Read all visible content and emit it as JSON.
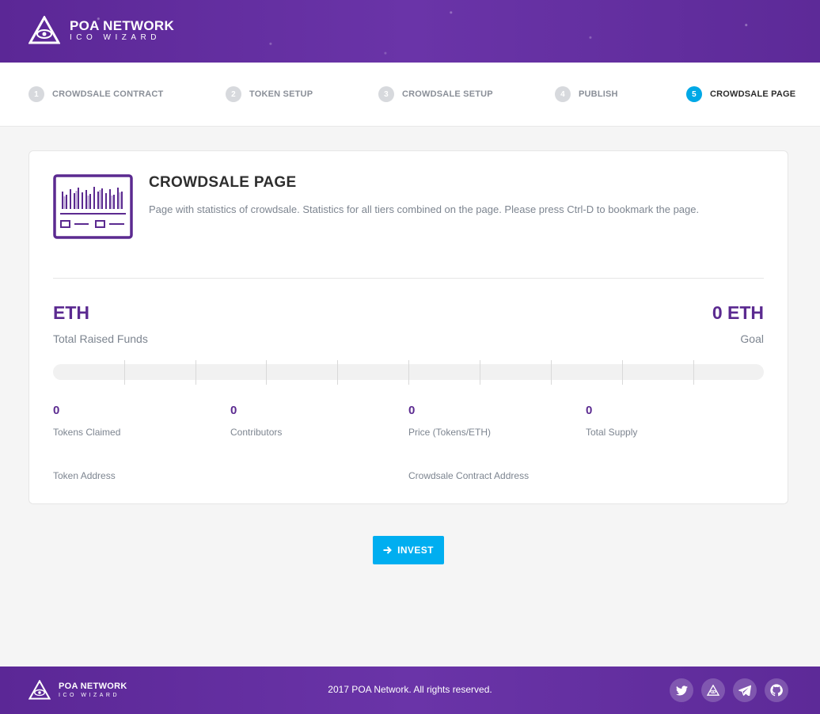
{
  "header": {
    "logo_title": "POA NETWORK",
    "logo_subtitle": "ICO WIZARD"
  },
  "steps": [
    {
      "num": "1",
      "label": "CROWDSALE CONTRACT",
      "active": false
    },
    {
      "num": "2",
      "label": "TOKEN SETUP",
      "active": false
    },
    {
      "num": "3",
      "label": "CROWDSALE SETUP",
      "active": false
    },
    {
      "num": "4",
      "label": "PUBLISH",
      "active": false
    },
    {
      "num": "5",
      "label": "CROWDSALE PAGE",
      "active": true
    }
  ],
  "card": {
    "title": "CROWDSALE PAGE",
    "description": "Page with statistics of crowdsale. Statistics for all tiers combined on the page. Please press Ctrl-D to bookmark the page.",
    "raised_value": "ETH",
    "raised_label": "Total Raised Funds",
    "goal_value": "0 ETH",
    "goal_label": "Goal",
    "progress_fraction": 0,
    "stats": [
      {
        "value": "0",
        "label": "Tokens Claimed"
      },
      {
        "value": "0",
        "label": "Contributors"
      },
      {
        "value": "0",
        "label": "Price (Tokens/ETH)"
      },
      {
        "value": "0",
        "label": "Total Supply"
      }
    ],
    "token_address_label": "Token Address",
    "contract_address_label": "Crowdsale Contract Address"
  },
  "invest_button": {
    "label": "INVEST",
    "icon": "arrow-right-icon"
  },
  "footer": {
    "logo_title": "POA NETWORK",
    "logo_subtitle": "ICO WIZARD",
    "copyright": "2017 POA Network. All rights reserved.",
    "social": [
      "twitter-icon",
      "poa-icon",
      "telegram-icon",
      "github-icon"
    ]
  },
  "colors": {
    "brand_purple": "#5b2a90",
    "accent_blue": "#00aef0",
    "active_step": "#00a8e6"
  }
}
